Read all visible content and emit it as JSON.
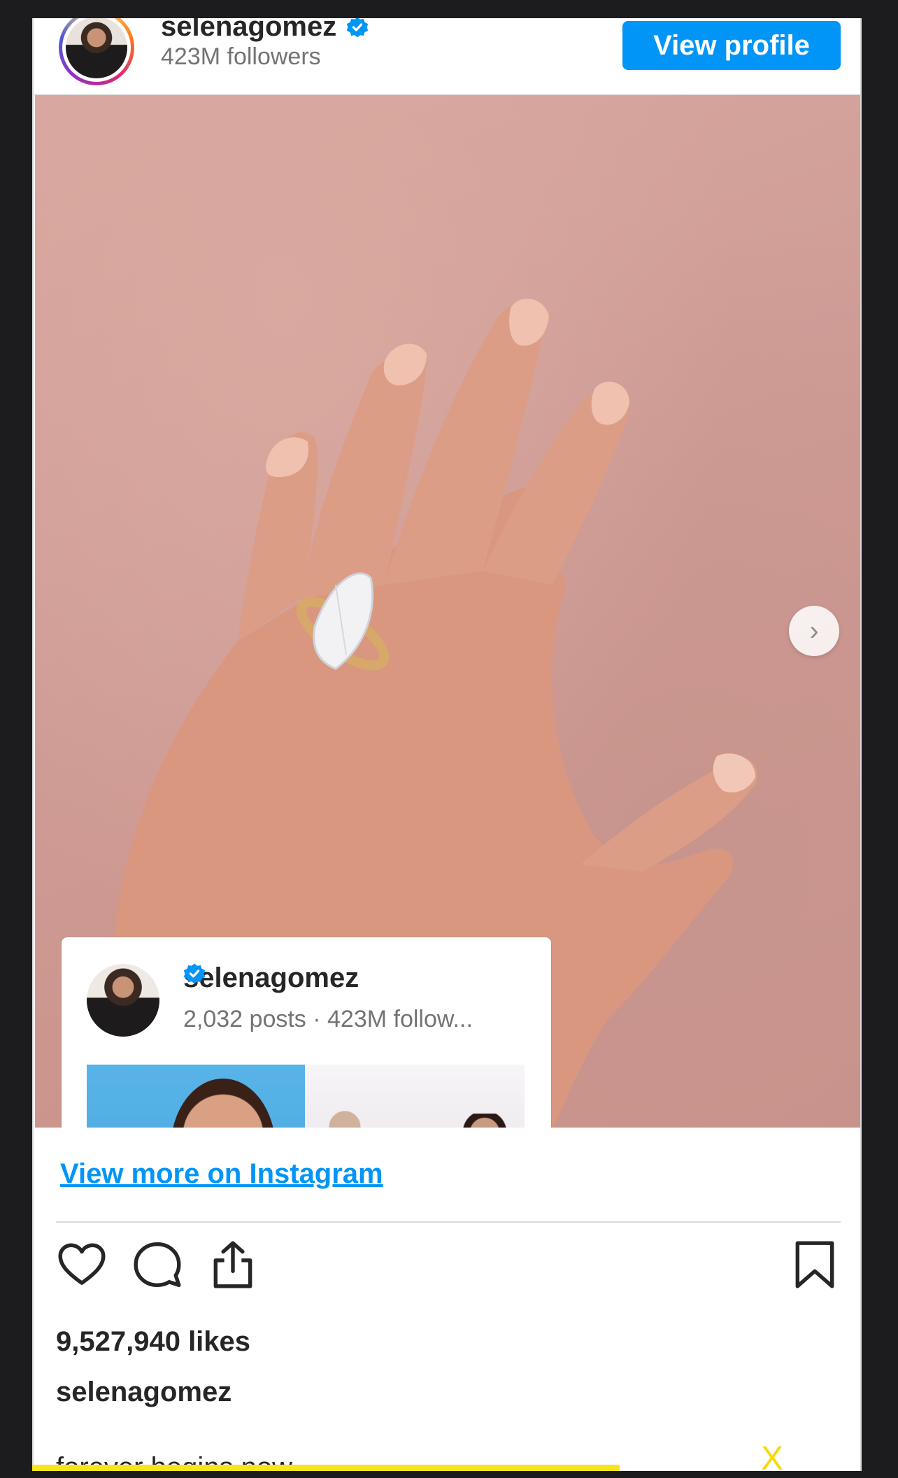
{
  "header": {
    "username": "selenagomez",
    "followers": "423M followers",
    "view_profile_label": "View profile"
  },
  "photo": {
    "next_icon": "chevron-right-icon"
  },
  "profile_card": {
    "username": "selenagomez",
    "stats": "2,032 posts · 423M follow..."
  },
  "links": {
    "view_more": "View more on Instagram"
  },
  "post": {
    "likes": "9,527,940 likes",
    "caption_user": "selenagomez",
    "caption_text": "forever begins now.."
  },
  "overlay": {
    "close_label": "X"
  },
  "colors": {
    "accent": "#0095f6",
    "verified": "#0095f6",
    "overlay_yellow": "#f5d90a"
  }
}
